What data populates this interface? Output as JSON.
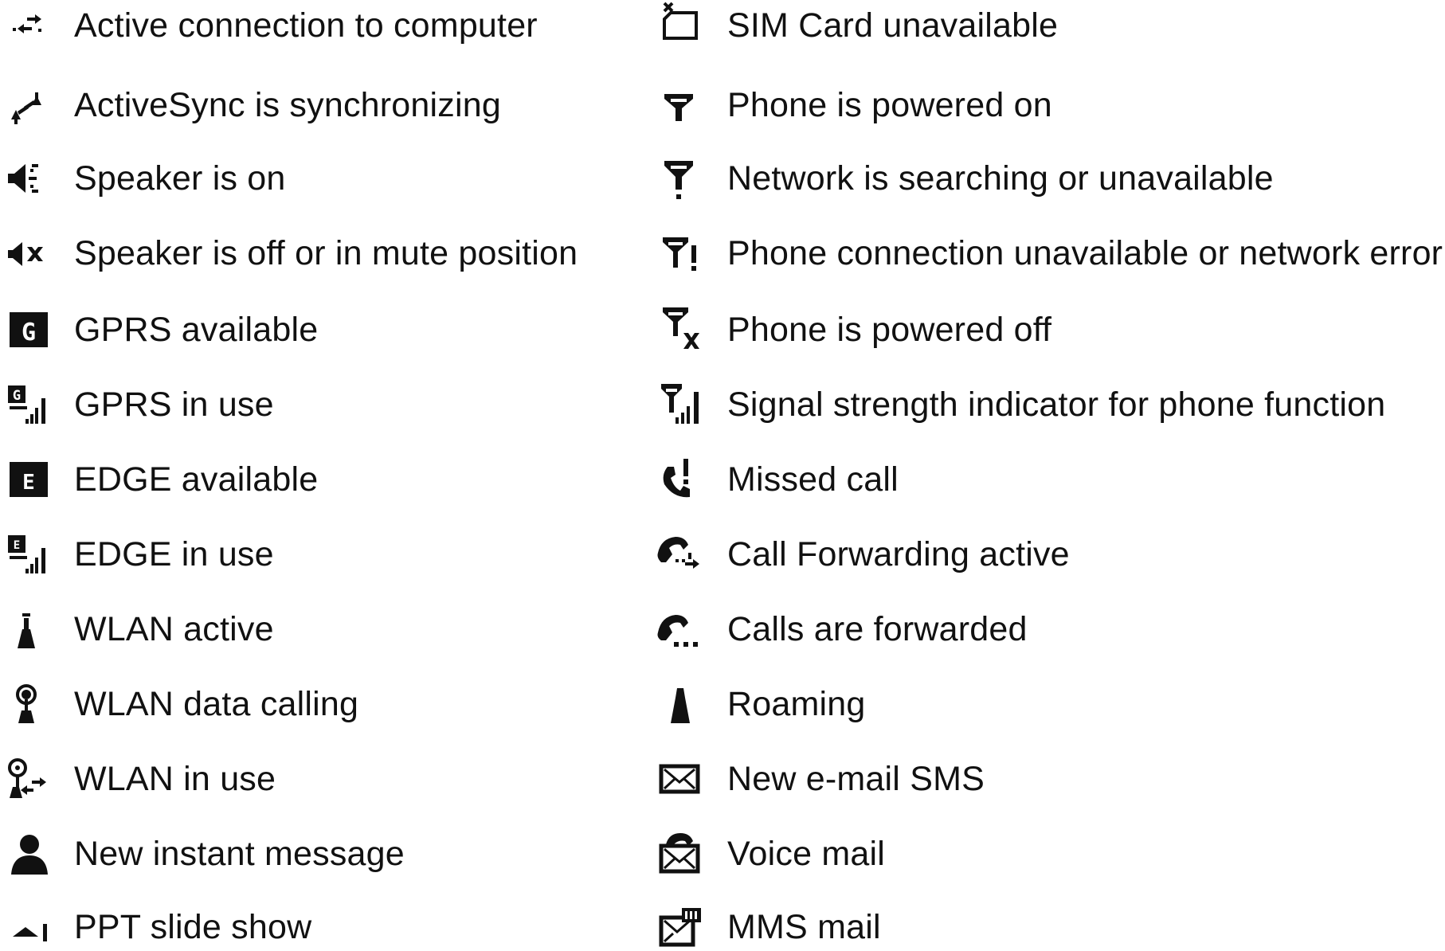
{
  "left_column": [
    {
      "icon": "active-connection-icon",
      "label": "Active connection to computer"
    },
    {
      "icon": "activesync-icon",
      "label": "ActiveSync is synchronizing"
    },
    {
      "icon": "speaker-on-icon",
      "label": "Speaker is on"
    },
    {
      "icon": "speaker-mute-icon",
      "label": "Speaker is off or in mute position"
    },
    {
      "icon": "gprs-available-icon",
      "label": "GPRS available"
    },
    {
      "icon": "gprs-in-use-icon",
      "label": "GPRS in use"
    },
    {
      "icon": "edge-available-icon",
      "label": "EDGE available"
    },
    {
      "icon": "edge-in-use-icon",
      "label": "EDGE in use"
    },
    {
      "icon": "wlan-active-icon",
      "label": "WLAN active"
    },
    {
      "icon": "wlan-data-calling-icon",
      "label": "WLAN data calling"
    },
    {
      "icon": "wlan-in-use-icon",
      "label": "WLAN in use"
    },
    {
      "icon": "instant-message-icon",
      "label": "New instant message"
    },
    {
      "icon": "ppt-slide-show-icon",
      "label": "PPT slide show"
    }
  ],
  "right_column": [
    {
      "icon": "sim-card-unavailable-icon",
      "label": "SIM Card unavailable"
    },
    {
      "icon": "phone-powered-on-icon",
      "label": "Phone is powered on"
    },
    {
      "icon": "network-searching-icon",
      "label": "Network is searching or unavailable"
    },
    {
      "icon": "network-error-icon",
      "label": "Phone connection unavailable or network error"
    },
    {
      "icon": "phone-powered-off-icon",
      "label": "Phone is powered off"
    },
    {
      "icon": "signal-strength-icon",
      "label": "Signal strength indicator for phone function"
    },
    {
      "icon": "missed-call-icon",
      "label": "Missed call"
    },
    {
      "icon": "call-forwarding-active-icon",
      "label": "Call Forwarding active"
    },
    {
      "icon": "calls-forwarded-icon",
      "label": "Calls are forwarded"
    },
    {
      "icon": "roaming-icon",
      "label": "Roaming"
    },
    {
      "icon": "new-email-sms-icon",
      "label": "New e-mail SMS"
    },
    {
      "icon": "voice-mail-icon",
      "label": "Voice mail"
    },
    {
      "icon": "mms-mail-icon",
      "label": "MMS mail"
    }
  ],
  "icon_glyphs": {
    "gprs": "G",
    "edge": "E"
  }
}
